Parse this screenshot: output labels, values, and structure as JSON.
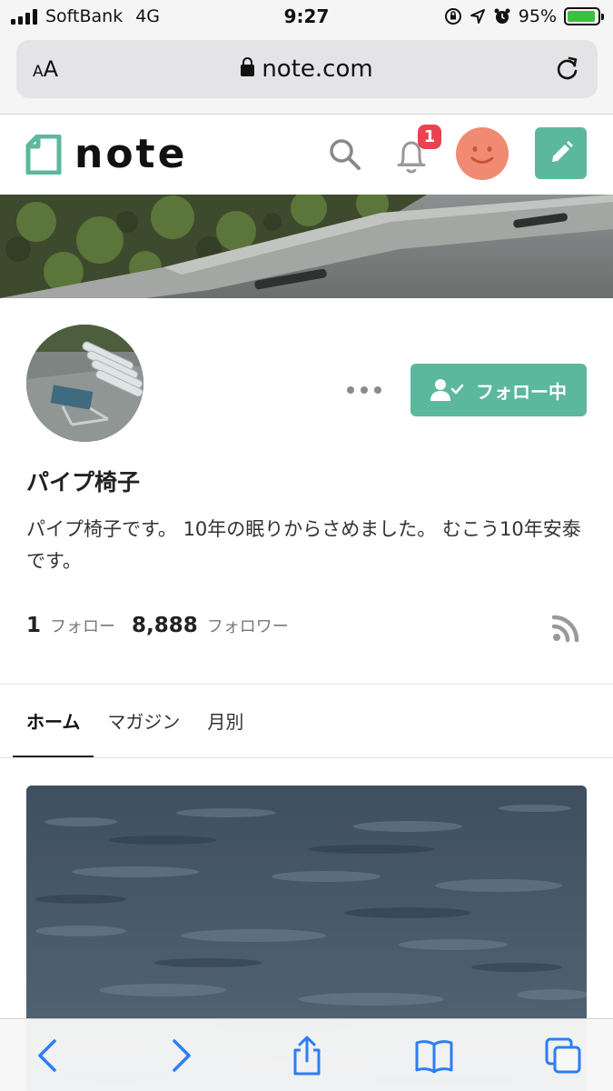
{
  "status_bar": {
    "carrier": "SoftBank",
    "network": "4G",
    "time": "9:27",
    "battery": "95%",
    "battery_level": 0.95
  },
  "browser": {
    "text_size_label_small": "A",
    "text_size_label_large": "A",
    "url": "note.com"
  },
  "header": {
    "logo_text": "note",
    "notification_count": "1"
  },
  "profile": {
    "follow_button_label": "フォロー中",
    "name": "パイプ椅子",
    "bio": "パイプ椅子です。 10年の眠りからさめました。 むこう10年安泰です。",
    "following_count": "1",
    "following_label": "フォロー",
    "followers_count": "8,888",
    "followers_label": "フォロワー"
  },
  "tabs": [
    {
      "label": "ホーム",
      "active": true
    },
    {
      "label": "マガジン",
      "active": false
    },
    {
      "label": "月別",
      "active": false
    }
  ],
  "colors": {
    "brand_green": "#5cb89c",
    "badge_red": "#e8434e",
    "avatar_orange": "#f08a73",
    "ios_blue": "#2b7ef6"
  }
}
